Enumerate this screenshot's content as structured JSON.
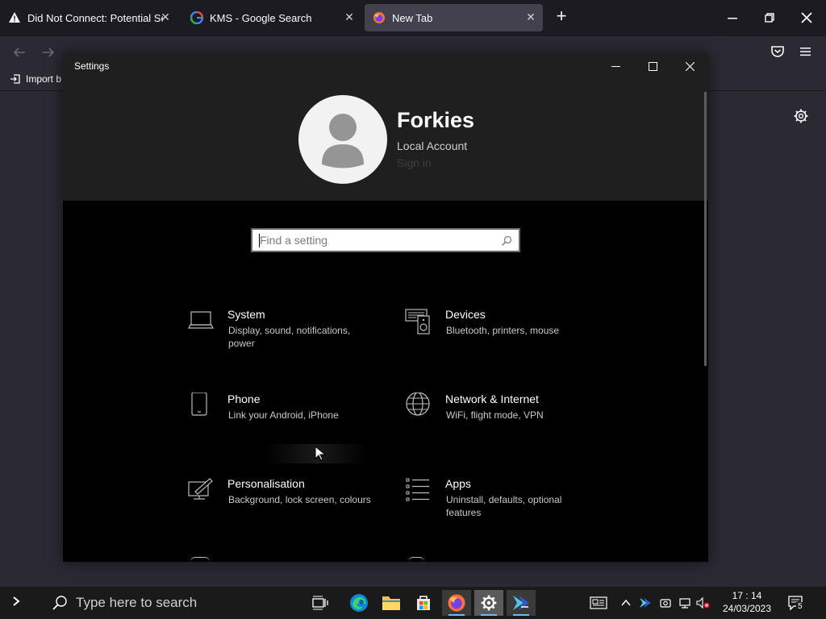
{
  "browser": {
    "tabs": [
      {
        "label": "Did Not Connect: Potential Security Issue",
        "icon": "warning-icon"
      },
      {
        "label": "KMS - Google Search",
        "icon": "google-icon"
      },
      {
        "label": "New Tab",
        "icon": "firefox-icon"
      }
    ],
    "bookmarks": {
      "import_label": "Import b"
    }
  },
  "settings": {
    "window_title": "Settings",
    "user": {
      "name": "Forkies",
      "account_type": "Local Account",
      "sign_in": "Sign in"
    },
    "search": {
      "placeholder": "Find a setting"
    },
    "categories": [
      {
        "title": "System",
        "desc": "Display, sound, notifications, power",
        "icon": "laptop-icon"
      },
      {
        "title": "Devices",
        "desc": "Bluetooth, printers, mouse",
        "icon": "devices-icon"
      },
      {
        "title": "Phone",
        "desc": "Link your Android, iPhone",
        "icon": "phone-icon"
      },
      {
        "title": "Network & Internet",
        "desc": "WiFi, flight mode, VPN",
        "icon": "globe-icon"
      },
      {
        "title": "Personalisation",
        "desc": "Background, lock screen, colours",
        "icon": "paint-icon"
      },
      {
        "title": "Apps",
        "desc": "Uninstall, defaults, optional features",
        "icon": "apps-list-icon"
      }
    ]
  },
  "taskbar": {
    "search_placeholder": "Type here to search",
    "time": "17 : 14",
    "date": "24/03/2023",
    "notification_count": "5"
  },
  "colors": {
    "accent": "#76b9ed",
    "window_bg": "#000000",
    "header_bg": "#1f1f1f",
    "browser_bg": "#2b2a33"
  }
}
